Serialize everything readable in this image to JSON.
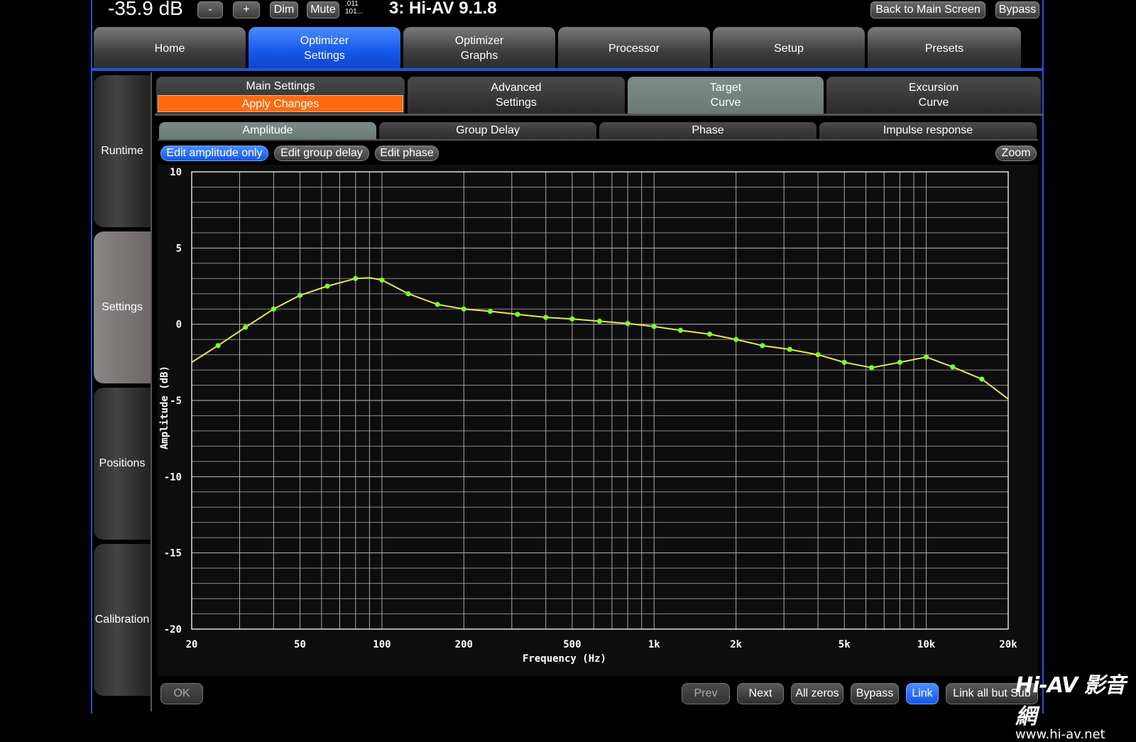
{
  "topbar": {
    "volume": "-35.9 dB",
    "minus_label": "-",
    "plus_label": "+",
    "dim_label": "Dim",
    "mute_label": "Mute",
    "bits_line1": ".011",
    "bits_line2": "101...",
    "device_title": "3: Hi-AV 9.1.8",
    "back_label": "Back to Main Screen",
    "bypass_label": "Bypass"
  },
  "main_tabs": [
    {
      "label": "Home"
    },
    {
      "label1": "Optimizer",
      "label2": "Settings",
      "active": true
    },
    {
      "label1": "Optimizer",
      "label2": "Graphs"
    },
    {
      "label": "Processor"
    },
    {
      "label": "Setup"
    },
    {
      "label": "Presets"
    }
  ],
  "side_tabs": [
    {
      "label": "Runtime"
    },
    {
      "label": "Settings",
      "active": true
    },
    {
      "label": "Positions"
    },
    {
      "label": "Calibration"
    }
  ],
  "sub_tabs": {
    "main_settings": "Main Settings",
    "apply_changes": "Apply Changes",
    "advanced_1": "Advanced",
    "advanced_2": "Settings",
    "target_1": "Target",
    "target_2": "Curve",
    "excursion_1": "Excursion",
    "excursion_2": "Curve"
  },
  "graph_tabs": [
    "Amplitude",
    "Group Delay",
    "Phase",
    "Impulse response"
  ],
  "edit_buttons": {
    "edit_amplitude": "Edit amplitude only",
    "edit_group_delay": "Edit group delay",
    "edit_phase": "Edit phase",
    "zoom": "Zoom"
  },
  "bottom_buttons": {
    "ok": "OK",
    "prev": "Prev",
    "next": "Next",
    "all_zeros": "All zeros",
    "bypass": "Bypass",
    "link": "Link",
    "link_all_but_sub": "Link all but Sub"
  },
  "watermark": {
    "logo": "Hi-AV 影音網",
    "url": "www.hi-av.net"
  },
  "colors": {
    "accent_blue": "#1457e8",
    "apply_orange": "#ff6a10",
    "curve": "#e8e84a",
    "points": "#7cff2a"
  },
  "chart_data": {
    "type": "line",
    "xscale": "log",
    "xlim": [
      20,
      20000
    ],
    "ylim": [
      -20,
      10
    ],
    "xlabel": "Frequency (Hz)",
    "ylabel": "Amplitude (dB)",
    "xticks": [
      {
        "v": 20,
        "label": "20"
      },
      {
        "v": 50,
        "label": "50"
      },
      {
        "v": 100,
        "label": "100"
      },
      {
        "v": 200,
        "label": "200"
      },
      {
        "v": 500,
        "label": "500"
      },
      {
        "v": 1000,
        "label": "1k"
      },
      {
        "v": 2000,
        "label": "2k"
      },
      {
        "v": 5000,
        "label": "5k"
      },
      {
        "v": 10000,
        "label": "10k"
      },
      {
        "v": 20000,
        "label": "20k"
      }
    ],
    "yticks": [
      10,
      5,
      0,
      -5,
      -10,
      -15,
      -20
    ],
    "grid": true,
    "curve": [
      [
        20,
        -2.5
      ],
      [
        25,
        -1.4
      ],
      [
        31.5,
        -0.2
      ],
      [
        40,
        1.0
      ],
      [
        50,
        1.9
      ],
      [
        63,
        2.5
      ],
      [
        80,
        3.0
      ],
      [
        90,
        3.05
      ],
      [
        100,
        2.9
      ],
      [
        125,
        2.0
      ],
      [
        160,
        1.3
      ],
      [
        200,
        1.0
      ],
      [
        250,
        0.85
      ],
      [
        315,
        0.65
      ],
      [
        400,
        0.45
      ],
      [
        500,
        0.35
      ],
      [
        630,
        0.2
      ],
      [
        800,
        0.05
      ],
      [
        1000,
        -0.15
      ],
      [
        1250,
        -0.4
      ],
      [
        1600,
        -0.65
      ],
      [
        2000,
        -1.0
      ],
      [
        2500,
        -1.4
      ],
      [
        3150,
        -1.65
      ],
      [
        4000,
        -2.0
      ],
      [
        5000,
        -2.5
      ],
      [
        6300,
        -2.85
      ],
      [
        8000,
        -2.5
      ],
      [
        10000,
        -2.15
      ],
      [
        12500,
        -2.8
      ],
      [
        16000,
        -3.6
      ],
      [
        20000,
        -4.9
      ]
    ],
    "points": [
      [
        25,
        -1.4
      ],
      [
        31.5,
        -0.2
      ],
      [
        40,
        1.0
      ],
      [
        50,
        1.9
      ],
      [
        63,
        2.5
      ],
      [
        80,
        3.0
      ],
      [
        100,
        2.9
      ],
      [
        125,
        2.0
      ],
      [
        160,
        1.3
      ],
      [
        200,
        1.0
      ],
      [
        250,
        0.85
      ],
      [
        315,
        0.65
      ],
      [
        400,
        0.45
      ],
      [
        500,
        0.35
      ],
      [
        630,
        0.2
      ],
      [
        800,
        0.05
      ],
      [
        1000,
        -0.15
      ],
      [
        1250,
        -0.4
      ],
      [
        1600,
        -0.65
      ],
      [
        2000,
        -1.0
      ],
      [
        2500,
        -1.4
      ],
      [
        3150,
        -1.65
      ],
      [
        4000,
        -2.0
      ],
      [
        5000,
        -2.5
      ],
      [
        6300,
        -2.85
      ],
      [
        8000,
        -2.5
      ],
      [
        10000,
        -2.15
      ],
      [
        12500,
        -2.8
      ],
      [
        16000,
        -3.6
      ]
    ]
  }
}
